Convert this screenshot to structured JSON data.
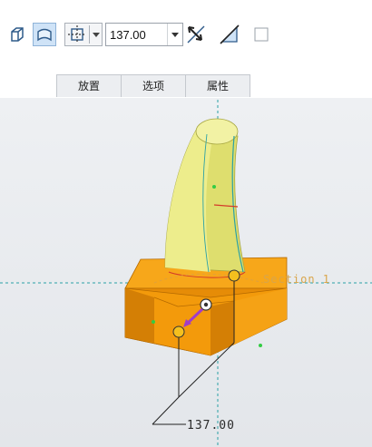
{
  "toolbar": {
    "solid_icon": "solid-body-icon",
    "surface_icon": "surface-icon",
    "direction_icon": "extrude-direction-icon",
    "depth_value": "137.00",
    "flip_icon": "flip-direction-icon",
    "remove_icon": "remove-material-icon",
    "thicken_icon": "thicken-checkbox"
  },
  "tabs": [
    {
      "label": "放置"
    },
    {
      "label": "选项"
    },
    {
      "label": "属性"
    }
  ],
  "viewport": {
    "section_label": "Section 1",
    "dimension_label": "137.00"
  },
  "colors": {
    "model_orange": "#f39a0b",
    "model_yellow": "#e2e37a",
    "datum_cyan": "#2aa0a6",
    "surface_selected": "#cfe3f7"
  }
}
